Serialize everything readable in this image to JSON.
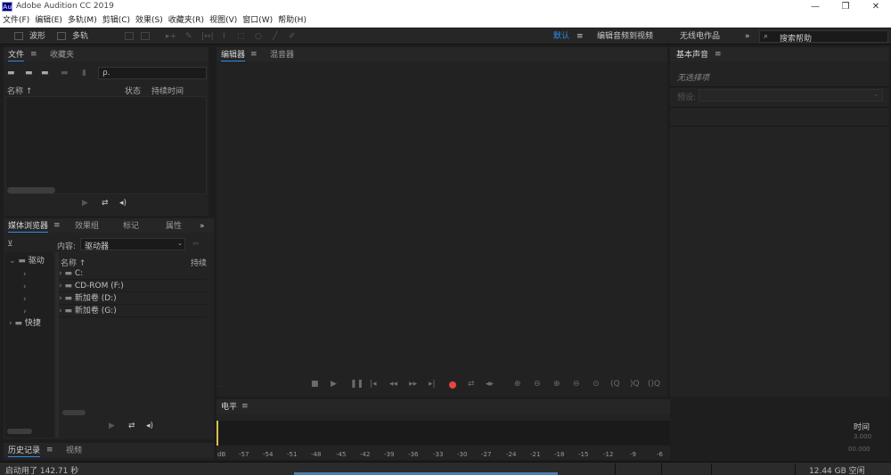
{
  "window": {
    "app_icon": "Au",
    "title": "Adobe Audition CC 2019",
    "minimize": "—",
    "maximize": "❐",
    "close": "✕"
  },
  "menu": [
    "文件(F)",
    "编辑(E)",
    "多轨(M)",
    "剪辑(C)",
    "效果(S)",
    "收藏夹(R)",
    "视图(V)",
    "窗口(W)",
    "帮助(H)"
  ],
  "toolbar": {
    "waveform_label": "波形",
    "multitrack_label": "多轨",
    "workspaces": [
      "默认",
      "编辑音频到视频",
      "无线电作品"
    ],
    "active_workspace": "默认",
    "more": "»",
    "search_placeholder": "搜索帮助"
  },
  "files_panel": {
    "tabs": [
      "文件",
      "收藏夹"
    ],
    "search_prefix": "ρ.",
    "columns": {
      "name": "名称 ↑",
      "status": "状态",
      "duration": "持续时间"
    }
  },
  "media_panel": {
    "tabs": [
      "媒体浏览器",
      "效果组",
      "标记",
      "属性"
    ],
    "more": "»",
    "content_label": "内容:",
    "content_value": "驱动器",
    "tree": [
      "驱动",
      "快捷"
    ],
    "columns": {
      "name": "名称 ↑",
      "duration": "持续"
    },
    "rows": [
      "C:",
      "CD-ROM (F:)",
      "新加卷 (D:)",
      "新加卷 (G:)"
    ]
  },
  "history_panel": {
    "tabs": [
      "历史记录",
      "视频"
    ]
  },
  "editor_panel": {
    "tabs": [
      "编辑器",
      "混音器"
    ],
    "transport_icons": [
      "stop-icon",
      "play-icon",
      "pause-icon",
      "rewind-start-icon",
      "rewind-icon",
      "forward-icon",
      "forward-end-icon",
      "record-icon",
      "loop-icon",
      "skip-icon"
    ],
    "record_color": "#e8453c"
  },
  "levels_panel": {
    "title": "电平",
    "db_label": "dB",
    "ticks": [
      "-57",
      "-54",
      "-51",
      "-48",
      "-45",
      "-42",
      "-39",
      "-36",
      "-33",
      "-30",
      "-27",
      "-24",
      "-21",
      "-18",
      "-15",
      "-12",
      "-9",
      "-6"
    ]
  },
  "essential_sound": {
    "title": "基本声音",
    "no_selection": "无选择项",
    "preset_label": "预设:",
    "time_label": "时间",
    "value1": "3.000",
    "value2": "00.000"
  },
  "status": {
    "startup": "启动用了 142.71 秒",
    "disk": "12.44 GB 空闲"
  },
  "colors": {
    "accent": "#2d8ceb",
    "level_marker": "#d8c34b"
  }
}
